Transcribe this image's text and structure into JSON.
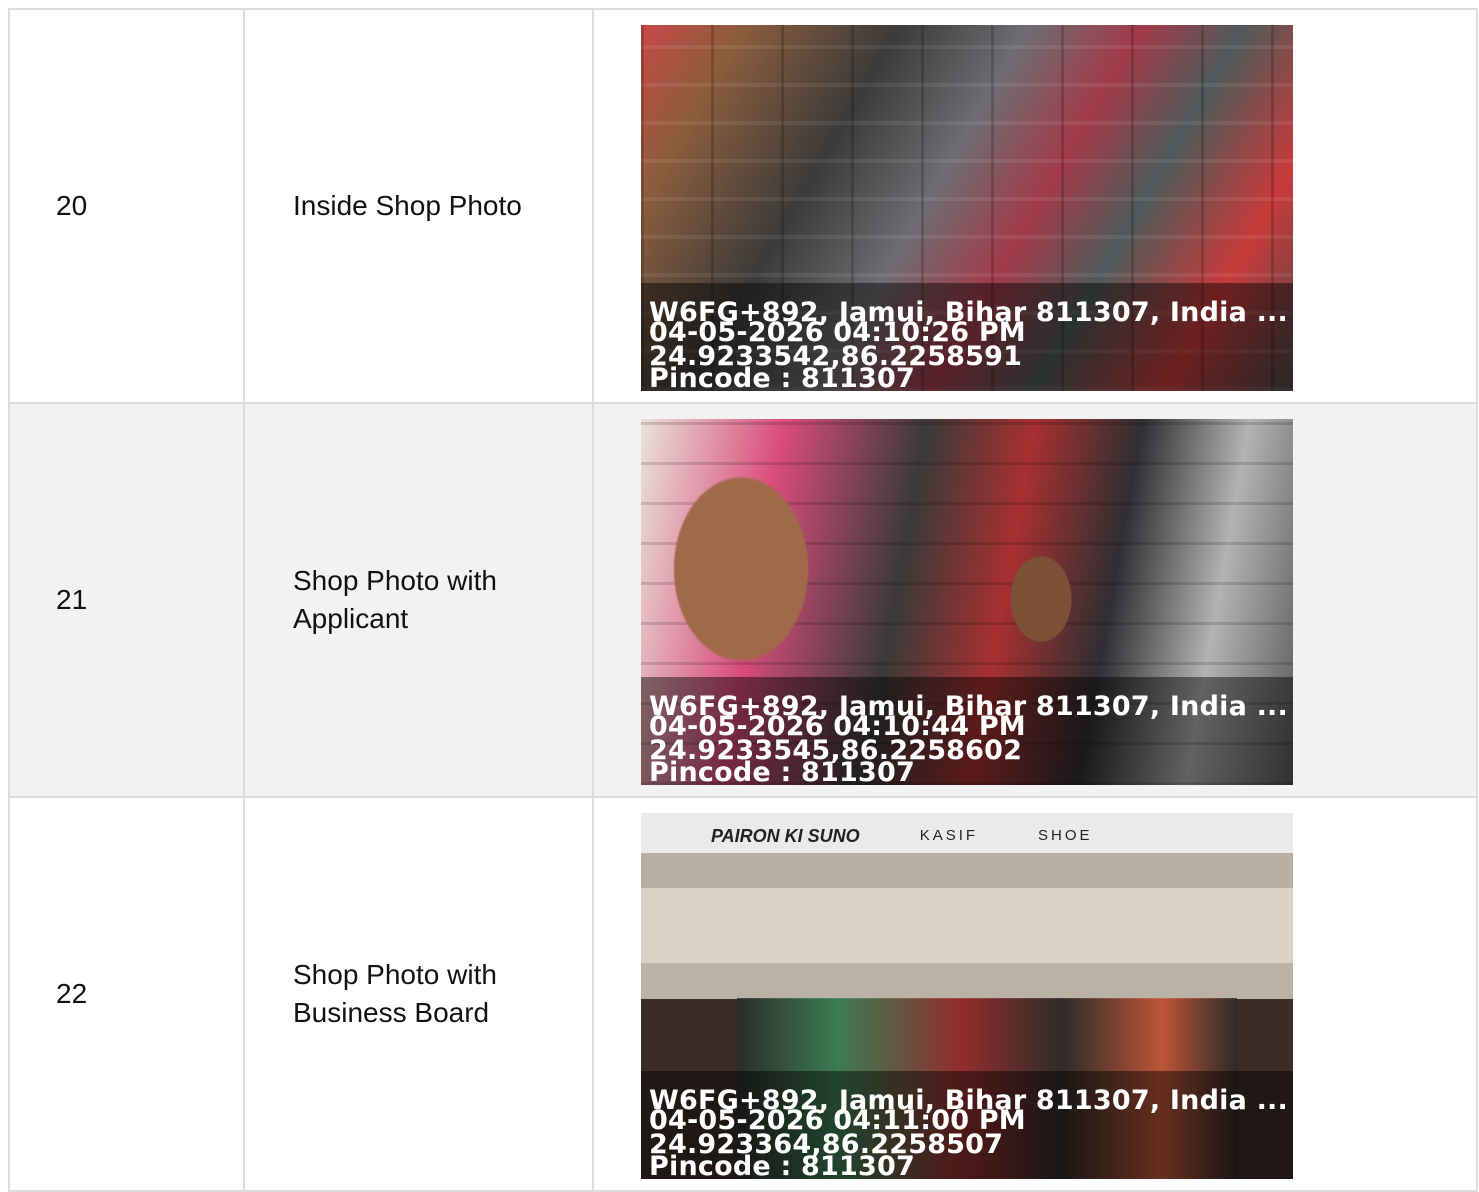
{
  "rows": [
    {
      "num": "20",
      "label": "Inside Shop Photo",
      "photo": {
        "icon": "shop-interior-photo",
        "address": "W6FG+892, Jamui, Bihar 811307, India ...",
        "datetime": "04-05-2026 04:10:26 PM",
        "coords": "24.9233542,86.2258591",
        "pincode": "Pincode : 811307"
      }
    },
    {
      "num": "21",
      "label": "Shop Photo with Applicant",
      "photo": {
        "icon": "applicant-shop-photo",
        "address": "W6FG+892, Jamui, Bihar 811307, India ...",
        "datetime": "04-05-2026 04:10:44 PM",
        "coords": "24.9233545,86.2258602",
        "pincode": "Pincode : 811307"
      }
    },
    {
      "num": "22",
      "label": "Shop Photo with Business Board",
      "photo": {
        "icon": "business-board-photo",
        "board_text": [
          "PAIRON KI SUNO",
          "KASIF",
          "SHOE"
        ],
        "address": "W6FG+892, Jamui, Bihar 811307, India ...",
        "datetime": "04-05-2026 04:11:00 PM",
        "coords": "24.923364,86.2258507",
        "pincode": "Pincode : 811307"
      }
    }
  ]
}
